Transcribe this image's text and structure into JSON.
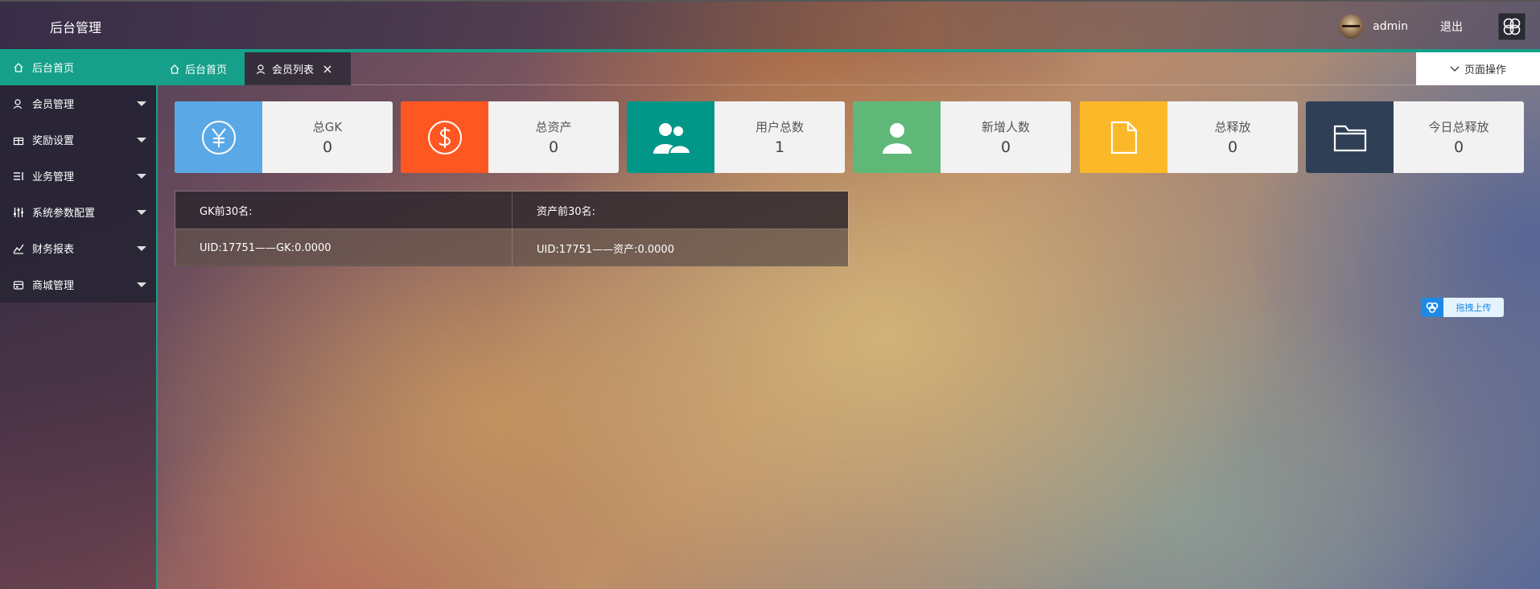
{
  "header": {
    "title": "后台管理",
    "username": "admin",
    "logout_label": "退出",
    "accent_color": "#16a089"
  },
  "sidebar": {
    "items": [
      {
        "label": "后台首页",
        "icon": "home-icon",
        "active": true
      },
      {
        "label": "会员管理",
        "icon": "user-icon"
      },
      {
        "label": "奖励设置",
        "icon": "gift-icon"
      },
      {
        "label": "业务管理",
        "icon": "list-icon"
      },
      {
        "label": "系统参数配置",
        "icon": "sliders-icon"
      },
      {
        "label": "财务报表",
        "icon": "chart-icon"
      },
      {
        "label": "商城管理",
        "icon": "store-icon"
      }
    ]
  },
  "tabs": {
    "home_label": "后台首页",
    "members_label": "会员列表",
    "page_ops_label": "页面操作"
  },
  "stats": [
    {
      "label": "总GK",
      "value": "0",
      "color": "#5aa9e6",
      "icon": "yuan-icon"
    },
    {
      "label": "总资产",
      "value": "0",
      "color": "#ff5722",
      "icon": "dollar-icon"
    },
    {
      "label": "用户总数",
      "value": "1",
      "color": "#009688",
      "icon": "users-icon"
    },
    {
      "label": "新增人数",
      "value": "0",
      "color": "#5fb878",
      "icon": "person-icon"
    },
    {
      "label": "总释放",
      "value": "0",
      "color": "#fbb829",
      "icon": "file-icon"
    },
    {
      "label": "今日总释放",
      "value": "0",
      "color": "#2f4056",
      "icon": "folder-icon"
    }
  ],
  "ranking": {
    "gk_header": "GK前30名:",
    "asset_header": "资产前30名:",
    "gk_entry": "UID:17751——GK:0.0000",
    "asset_entry": "UID:17751——资产:0.0000"
  },
  "upload": {
    "label": "拖拽上传"
  }
}
